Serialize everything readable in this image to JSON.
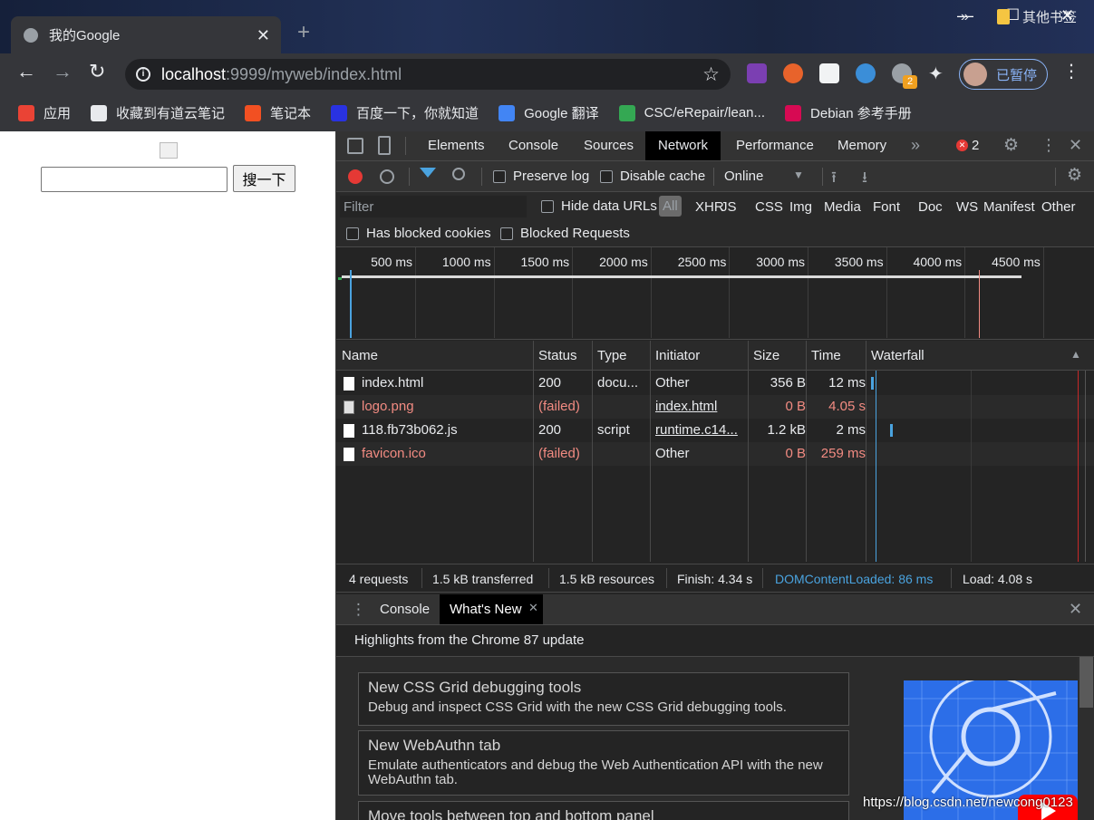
{
  "browser": {
    "tab_title": "我的Google",
    "new_tab_symbol": "+",
    "window_controls": {
      "minimize": "—",
      "maximize": "☐",
      "close": "✕"
    },
    "url_host": "localhost",
    "url_rest": ":9999/myweb/index.html",
    "profile_label": "已暂停",
    "ext_badge": "2",
    "bookmarks": [
      {
        "label": "应用",
        "icon": "apps-grid-icon",
        "color": "#ea4335"
      },
      {
        "label": "收藏到有道云笔记",
        "icon": "youdao-icon",
        "color": "#e8eaed"
      },
      {
        "label": "笔记本",
        "icon": "windows-logo-icon",
        "color": "#f25022"
      },
      {
        "label": "百度一下，你就知道",
        "icon": "baidu-paw-icon",
        "color": "#2932e1"
      },
      {
        "label": "Google 翻译",
        "icon": "google-translate-icon",
        "color": "#4285f4"
      },
      {
        "label": "CSC/eRepair/lean...",
        "icon": "csc-icon",
        "color": "#34a853"
      },
      {
        "label": "Debian 参考手册",
        "icon": "debian-swirl-icon",
        "color": "#d70a53"
      }
    ],
    "bookmarks_more": "»",
    "other_bookmarks": "其他书签"
  },
  "page": {
    "search_button": "搜一下",
    "search_value": ""
  },
  "devtools": {
    "tabs": [
      "Elements",
      "Console",
      "Sources",
      "Network",
      "Performance",
      "Memory"
    ],
    "active_tab": "Network",
    "more_tabs": "»",
    "error_count": "2",
    "toolbar": {
      "preserve_log": "Preserve log",
      "disable_cache": "Disable cache",
      "throttling": "Online"
    },
    "filter": {
      "placeholder": "Filter",
      "hide_data_urls": "Hide data URLs",
      "types": [
        "All",
        "XHR",
        "JS",
        "CSS",
        "Img",
        "Media",
        "Font",
        "Doc",
        "WS",
        "Manifest",
        "Other"
      ],
      "has_blocked_cookies": "Has blocked cookies",
      "blocked_requests": "Blocked Requests"
    },
    "overview_ticks": [
      "500 ms",
      "1000 ms",
      "1500 ms",
      "2000 ms",
      "2500 ms",
      "3000 ms",
      "3500 ms",
      "4000 ms",
      "4500 ms",
      "500"
    ],
    "columns": [
      "Name",
      "Status",
      "Type",
      "Initiator",
      "Size",
      "Time",
      "Waterfall"
    ],
    "requests": [
      {
        "name": "index.html",
        "status": "200",
        "type": "docu...",
        "initiator": "Other",
        "size": "356 B",
        "time": "12 ms",
        "failed": false,
        "initiator_link": false
      },
      {
        "name": "logo.png",
        "status": "(failed)",
        "type": "",
        "initiator": "index.html",
        "size": "0 B",
        "time": "4.05 s",
        "failed": true,
        "initiator_link": true
      },
      {
        "name": "118.fb73b062.js",
        "status": "200",
        "type": "script",
        "initiator": "runtime.c14...",
        "size": "1.2 kB",
        "time": "2 ms",
        "failed": false,
        "initiator_link": true
      },
      {
        "name": "favicon.ico",
        "status": "(failed)",
        "type": "",
        "initiator": "Other",
        "size": "0 B",
        "time": "259 ms",
        "failed": true,
        "initiator_link": false
      }
    ],
    "summary": {
      "requests": "4 requests",
      "transferred": "1.5 kB transferred",
      "resources": "1.5 kB resources",
      "finish": "Finish: 4.34 s",
      "dcl": "DOMContentLoaded: 86 ms",
      "load": "Load: 4.08 s"
    },
    "drawer": {
      "tabs": [
        "Console",
        "What's New"
      ],
      "active": "What's New",
      "highlights": "Highlights from the Chrome 87 update",
      "cards": [
        {
          "title": "New CSS Grid debugging tools",
          "desc": "Debug and inspect CSS Grid with the new CSS Grid debugging tools."
        },
        {
          "title": "New WebAuthn tab",
          "desc": "Emulate authenticators and debug the Web Authentication API with the new WebAuthn tab."
        },
        {
          "title": "Move tools between top and bottom panel",
          "desc": ""
        }
      ]
    }
  },
  "watermark": "https://blog.csdn.net/newcong0123",
  "colors": {
    "accent": "#8ab4f8",
    "error": "#f28b82",
    "dcl": "#4aa3df",
    "active_tab": "#000000"
  }
}
